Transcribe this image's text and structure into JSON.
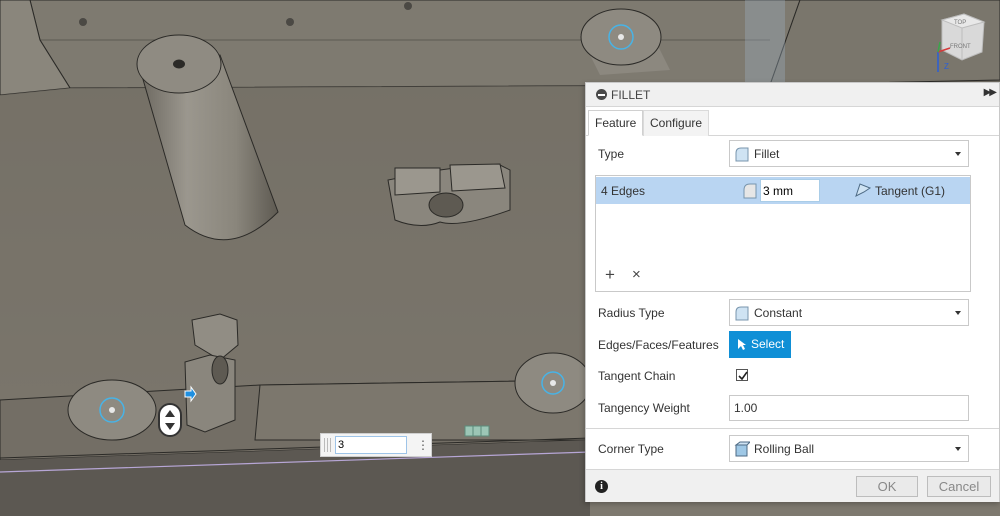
{
  "viewcube": {
    "top_label": "TOP",
    "front_label": "FRONT",
    "z_axis_label": "Z"
  },
  "inline_input": {
    "value": "3"
  },
  "dialog": {
    "title": "FILLET",
    "tabs": [
      {
        "label": "Feature",
        "active": true
      },
      {
        "label": "Configure",
        "active": false
      }
    ],
    "type": {
      "label": "Type",
      "value": "Fillet",
      "icon": "fillet-icon"
    },
    "edges": {
      "count_label": "4 Edges",
      "radius_value": "3 mm",
      "continuity_value": "Tangent (G1)",
      "add_symbol": "+",
      "remove_symbol": "×"
    },
    "radius_type": {
      "label": "Radius Type",
      "value": "Constant",
      "icon": "constant-radius-icon"
    },
    "selection": {
      "label": "Edges/Faces/Features",
      "button_label": "Select"
    },
    "tangent_chain": {
      "label": "Tangent Chain",
      "checked": true
    },
    "tangency_weight": {
      "label": "Tangency Weight",
      "value": "1.00"
    },
    "corner_type": {
      "label": "Corner Type",
      "value": "Rolling Ball",
      "icon": "rolling-ball-icon"
    },
    "footer": {
      "info_symbol": "i",
      "ok_label": "OK",
      "cancel_label": "Cancel"
    }
  },
  "colors": {
    "accent_blue": "#0f8fd6",
    "selection_row": "#b9d5f2",
    "model_surface": "#7b766c",
    "dialog_header": "#f0f0f0"
  }
}
